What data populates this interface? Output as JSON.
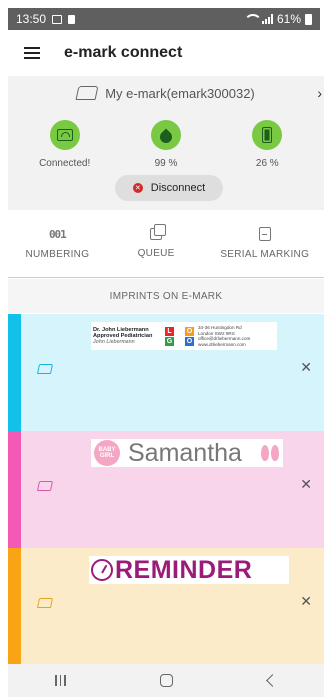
{
  "status_bar": {
    "time": "13:50",
    "battery": "61%"
  },
  "app_bar": {
    "title": "e-mark connect",
    "menu_icon": "hamburger-icon"
  },
  "device": {
    "name": "My e-mark(emark300032)",
    "stats": [
      {
        "icon": "wifi-router-icon",
        "label": "Connected!"
      },
      {
        "icon": "ink-drop-icon",
        "label": "99 %",
        "level": 99
      },
      {
        "icon": "battery-icon",
        "label": "26 %",
        "level": 26
      }
    ],
    "status_color": "#7ac943",
    "disconnect_label": "Disconnect",
    "disconnect_color": "#d02b2b"
  },
  "actions": [
    {
      "label": "NUMBERING",
      "icon": "numbering-icon",
      "glyph": "001"
    },
    {
      "label": "QUEUE",
      "icon": "queue-icon"
    },
    {
      "label": "SERIAL MARKING",
      "icon": "serial-marking-icon"
    }
  ],
  "imprints": {
    "header": "IMPRINTS ON E-MARK",
    "items": [
      {
        "id": "business-card",
        "accent": "#11c1ea",
        "background": "#d5f4fb",
        "content": {
          "name": "Dr. John Liebermann",
          "title": "Approved Pediatrician",
          "signature": "John Liebermann",
          "logo": [
            "L",
            "O",
            "G",
            "O"
          ],
          "address": [
            "34-36 Huntingdon Rd",
            "London SW2 9RS",
            "office@drliebermann.com",
            "www.drliebermann.com"
          ]
        }
      },
      {
        "id": "samantha",
        "accent": "#f25ab5",
        "background": "#f9d5ec",
        "content": {
          "badge": "BABY GIRL",
          "text": "Samantha"
        }
      },
      {
        "id": "reminder",
        "accent": "#f8a414",
        "background": "#fcebc8",
        "content": {
          "text": "REMINDER"
        }
      }
    ]
  }
}
